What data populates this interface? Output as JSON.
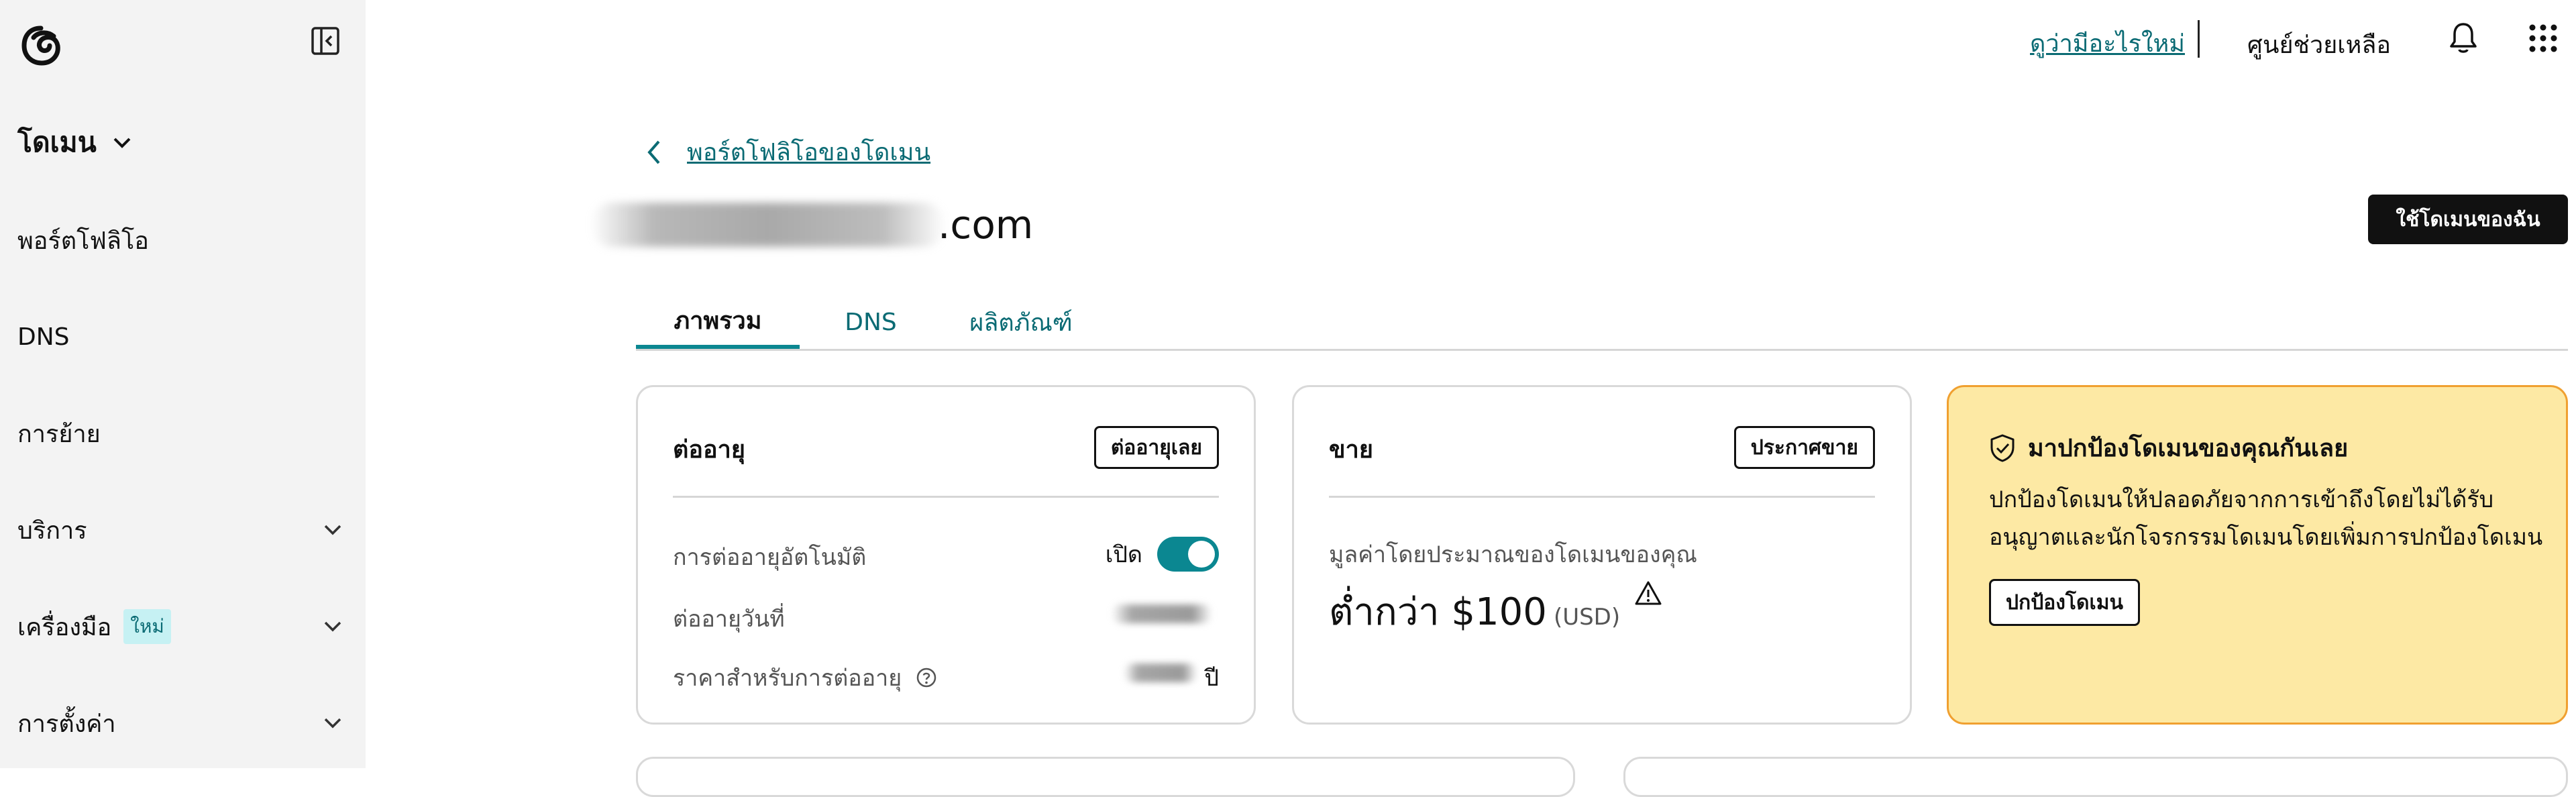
{
  "sidebar": {
    "section_title": "โดเมน",
    "items": [
      {
        "label": "พอร์ตโฟลิโอ"
      },
      {
        "label": "DNS"
      },
      {
        "label": "การย้าย"
      },
      {
        "label": "บริการ"
      },
      {
        "label": "เครื่องมือ",
        "badge": "ใหม่"
      },
      {
        "label": "การตั้งค่า"
      }
    ]
  },
  "topbar": {
    "whats_new": "ดูว่ามีอะไรใหม่",
    "help": "ศูนย์ช่วยเหลือ"
  },
  "breadcrumb": {
    "label": "พอร์ตโฟลิโอของโดเมน"
  },
  "domain": {
    "tld": ".com"
  },
  "actions": {
    "use_domain": "ใช้โดเมนของฉัน"
  },
  "tabs": [
    {
      "label": "ภาพรวม"
    },
    {
      "label": "DNS"
    },
    {
      "label": "ผลิตภัณฑ์"
    }
  ],
  "renewal_card": {
    "title": "ต่ออายุ",
    "button": "ต่ออายุเลย",
    "auto_renew_label": "การต่ออายุอัตโนมัติ",
    "auto_renew_state": "เปิด",
    "auto_renew_on": true,
    "renew_date_label": "ต่ออายุวันที่",
    "price_label": "ราคาสำหรับการต่ออายุ",
    "price_suffix": "ปี"
  },
  "sell_card": {
    "title": "ขาย",
    "button": "ประกาศขาย",
    "estimate_label": "มูลค่าโดยประมาณของโดเมนของคุณ",
    "estimate_value": "ต่ำกว่า $100",
    "currency": "(USD)"
  },
  "protect_card": {
    "title": "มาปกป้องโดเมนของคุณกันเลย",
    "body": "ปกป้องโดเมนให้ปลอดภัยจากการเข้าถึงโดยไม่ได้รับอนุญาตและนักโจรกรรมโดเมนโดยเพิ่มการปกป้องโดเมน",
    "button": "ปกป้องโดเมน"
  },
  "colors": {
    "accent": "#0b8791",
    "link": "#0b6b74",
    "sidebar_bg": "#f3f3f3",
    "promo_bg": "#fde9a4",
    "promo_border": "#f0a030"
  },
  "icons": [
    "logo-icon",
    "sidebar-collapse-icon",
    "chevron-down-icon",
    "chevron-left-icon",
    "bell-icon",
    "apps-grid-icon",
    "help-circle-icon",
    "warning-icon",
    "shield-check-icon"
  ]
}
